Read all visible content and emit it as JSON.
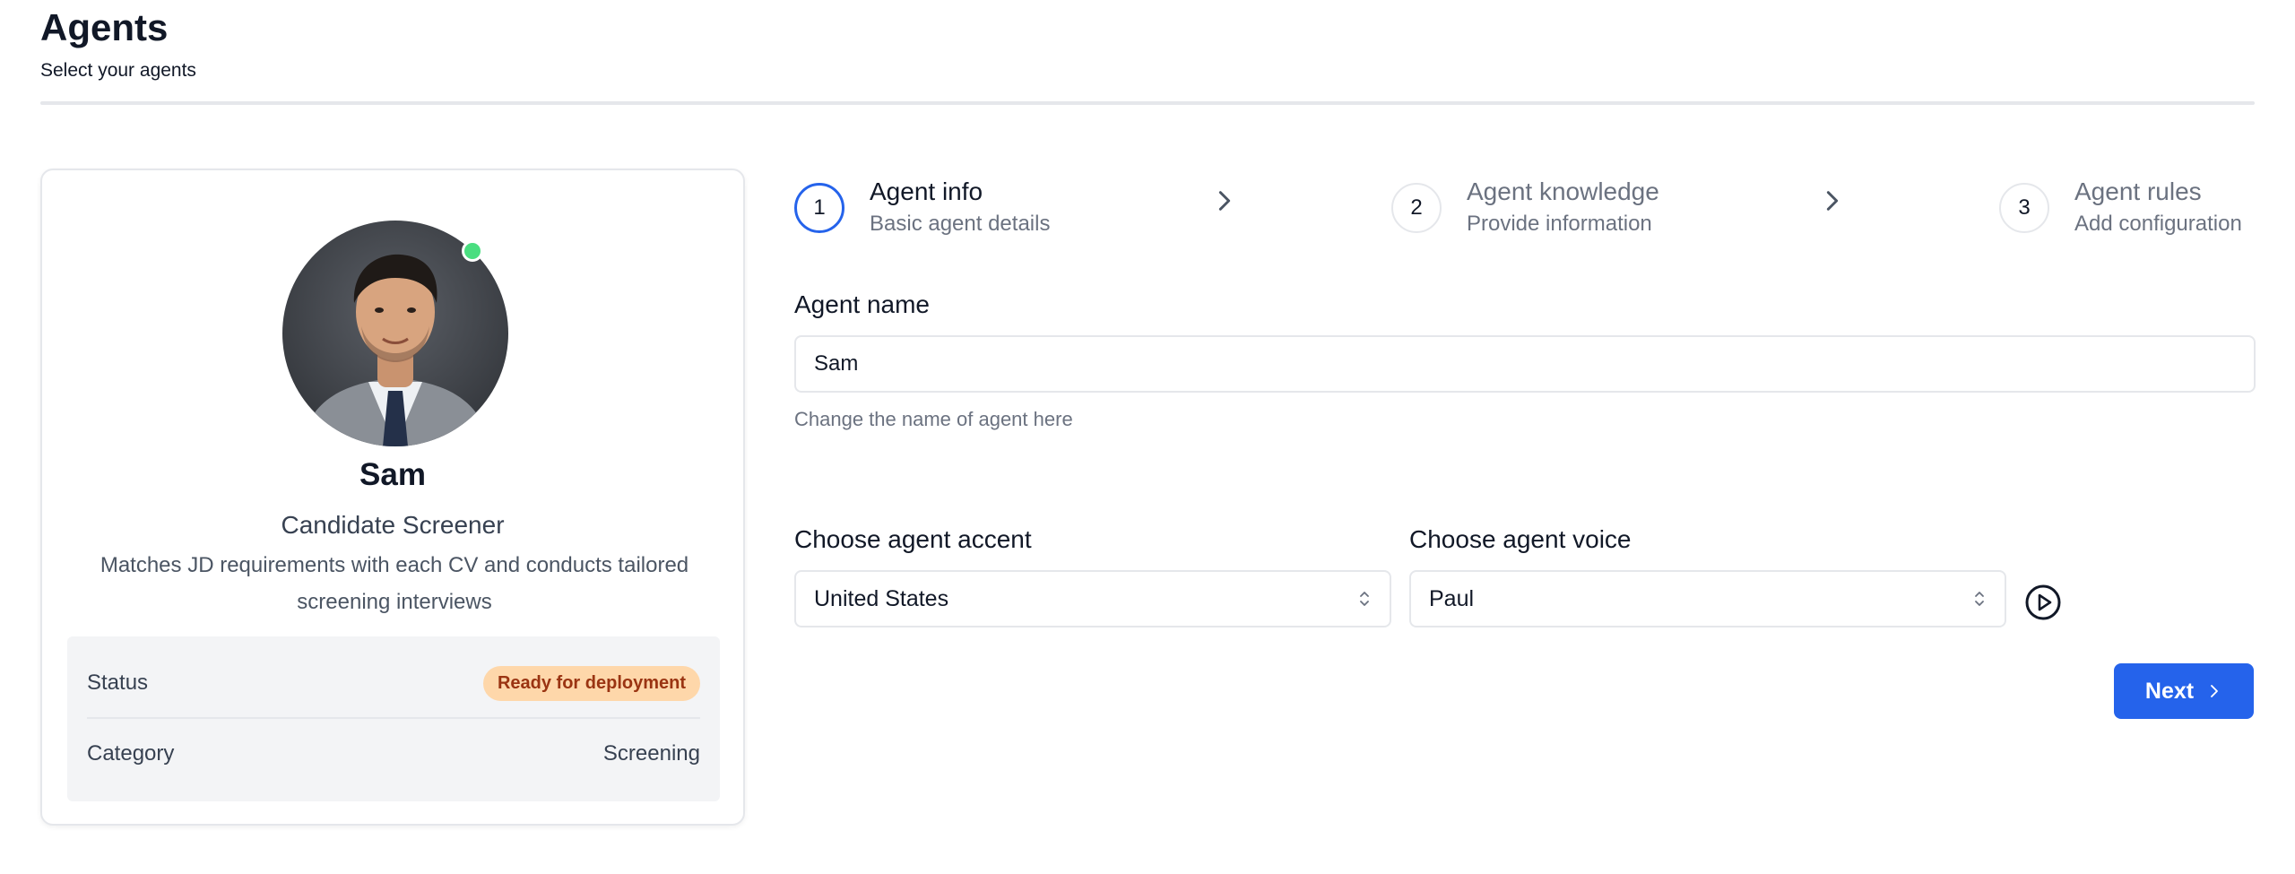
{
  "header": {
    "title": "Agents",
    "subtitle": "Select your agents"
  },
  "agent_card": {
    "avatar_icon": "person-avatar-icon",
    "online_status_color": "#4ade80",
    "name": "Sam",
    "role": "Candidate Screener",
    "description": "Matches JD requirements with each CV and conducts tailored screening interviews",
    "details": [
      {
        "label": "Status",
        "value": "Ready for deployment"
      },
      {
        "label": "Category",
        "value": "Screening"
      }
    ],
    "status_badge_colors": {
      "bg": "#fed7aa",
      "fg": "#9a3412"
    }
  },
  "stepper": {
    "steps": [
      {
        "number": "1",
        "title": "Agent info",
        "subtitle": "Basic agent details",
        "active": true
      },
      {
        "number": "2",
        "title": "Agent knowledge",
        "subtitle": "Provide information",
        "active": false
      },
      {
        "number": "3",
        "title": "Agent rules",
        "subtitle": "Add configuration",
        "active": false
      }
    ],
    "active_color": "#2563eb"
  },
  "form": {
    "agent_name": {
      "label": "Agent name",
      "value": "Sam",
      "help": "Change the name of agent here"
    },
    "accent": {
      "label": "Choose agent accent",
      "selected": "United States"
    },
    "voice": {
      "label": "Choose agent voice",
      "selected": "Paul"
    },
    "next_label": "Next",
    "accent_color": "#2563eb"
  }
}
